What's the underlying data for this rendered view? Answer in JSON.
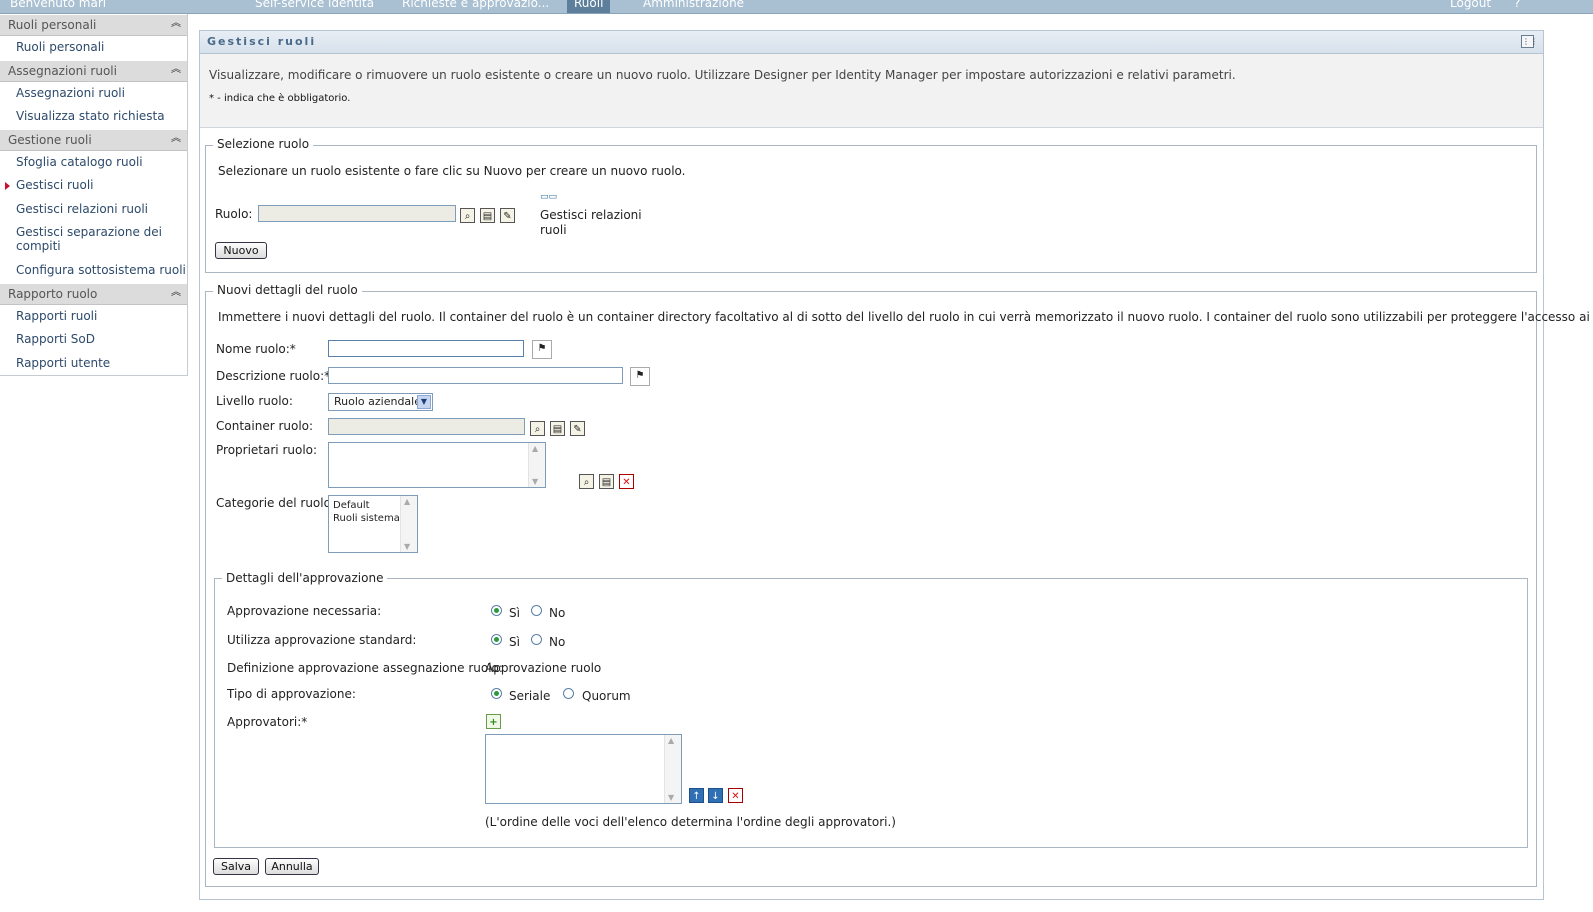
{
  "topbar": {
    "welcome": "Benvenuto mari",
    "tabs": [
      "Self-service identità",
      "Richieste e approvazio...",
      "Ruoli",
      "Amministrazione"
    ],
    "logout": "Logout",
    "help": "?"
  },
  "sidebar": {
    "sections": [
      {
        "title": "Ruoli personali",
        "items": [
          "Ruoli personali"
        ]
      },
      {
        "title": "Assegnazioni ruoli",
        "items": [
          "Assegnazioni ruoli",
          "Visualizza stato richiesta"
        ]
      },
      {
        "title": "Gestione ruoli",
        "items": [
          "Sfoglia catalogo ruoli",
          "Gestisci ruoli",
          "Gestisci relazioni ruoli",
          "Gestisci separazione dei compiti",
          "Configura sottosistema ruoli"
        ]
      },
      {
        "title": "Rapporto ruolo",
        "items": [
          "Rapporti ruoli",
          "Rapporti SoD",
          "Rapporti utente"
        ]
      }
    ]
  },
  "panel": {
    "title": "Gestisci ruoli",
    "description": "Visualizzare, modificare o rimuovere un ruolo esistente o creare un nuovo ruolo. Utilizzare Designer per Identity Manager per impostare autorizzazioni e relativi parametri.",
    "required_note": "* - indica che è obbligatorio."
  },
  "selection": {
    "legend": "Selezione ruolo",
    "hint": "Selezionare un ruolo esistente o fare clic su Nuovo per creare un nuovo ruolo.",
    "role_label": "Ruolo:",
    "relations_link_line1": "Gestisci relazioni",
    "relations_link_line2": "ruoli",
    "new_button": "Nuovo"
  },
  "details": {
    "legend": "Nuovi dettagli del ruolo",
    "hint": "Immettere i nuovi dettagli del ruolo. Il container del ruolo è un container directory facoltativo al di sotto del livello del ruolo in cui verrà memorizzato il nuovo ruolo. I container del ruolo sono utilizzabili per proteggere l'accesso ai ruoli.",
    "name_label": "Nome ruolo:*",
    "description_label": "Descrizione ruolo:*",
    "level_label": "Livello ruolo:",
    "level_value": "Ruolo aziendale",
    "container_label": "Container ruolo:",
    "owners_label": "Proprietari ruolo:",
    "categories_label": "Categorie del ruolo:",
    "categories": [
      "Default",
      "Ruoli sistema"
    ]
  },
  "approval": {
    "legend": "Dettagli dell'approvazione",
    "required_label": "Approvazione necessaria:",
    "standard_label": "Utilizza approvazione standard:",
    "definition_label": "Definizione approvazione assegnazione ruolo:",
    "definition_value": "Approvazione ruolo",
    "type_label": "Tipo di approvazione:",
    "approvers_label": "Approvatori:*",
    "yes": "Sì",
    "no": "No",
    "serial": "Seriale",
    "quorum": "Quorum",
    "order_note": "(L'ordine delle voci dell'elenco determina l'ordine degli approvatori.)"
  },
  "actions": {
    "save": "Salva",
    "cancel": "Annulla"
  }
}
